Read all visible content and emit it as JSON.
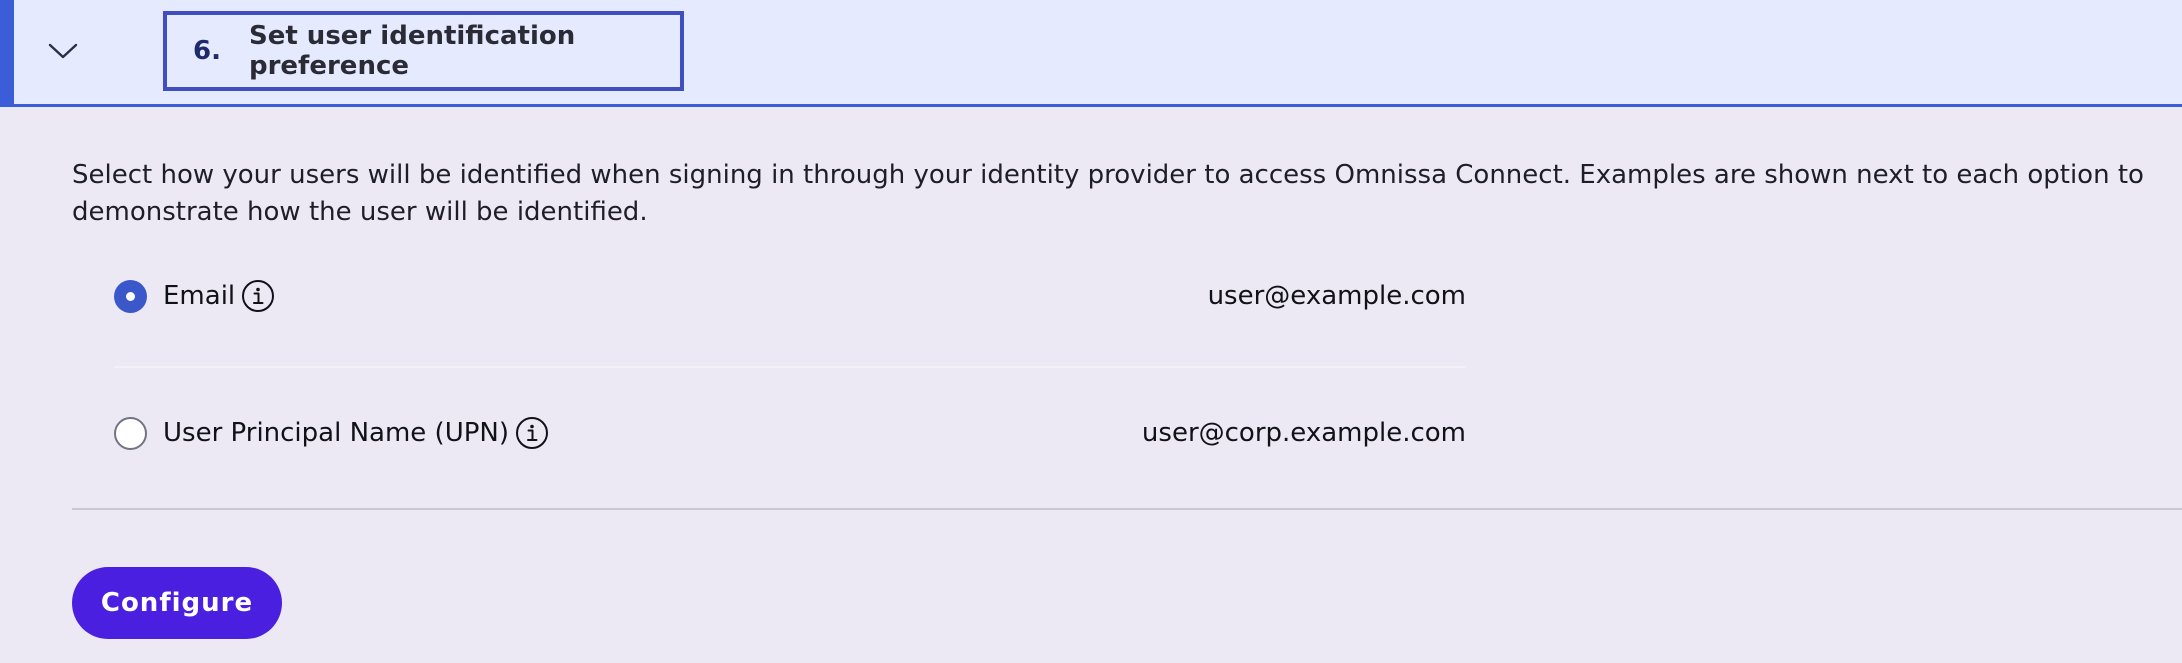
{
  "step": {
    "number": "6.",
    "title": "Set user identification preference",
    "toggle_icon": "chevron-down-icon"
  },
  "description": "Select how your users will be identified when signing in through your identity provider to access Omnissa Connect. Examples are shown next to each option to demonstrate how the user will be identified.",
  "options": [
    {
      "label": "Email",
      "example": "user@example.com",
      "selected": true,
      "info_icon": "info-icon"
    },
    {
      "label": "User Principal Name (UPN)",
      "example": "user@corp.example.com",
      "selected": false,
      "info_icon": "info-icon"
    }
  ],
  "actions": {
    "configure_label": "Configure"
  },
  "colors": {
    "accent": "#3b5ed8",
    "header_background": "#e5eaff",
    "page_background": "#ece9f5",
    "primary_button": "#4a1fe0",
    "radio_selected": "#3a58c9"
  }
}
